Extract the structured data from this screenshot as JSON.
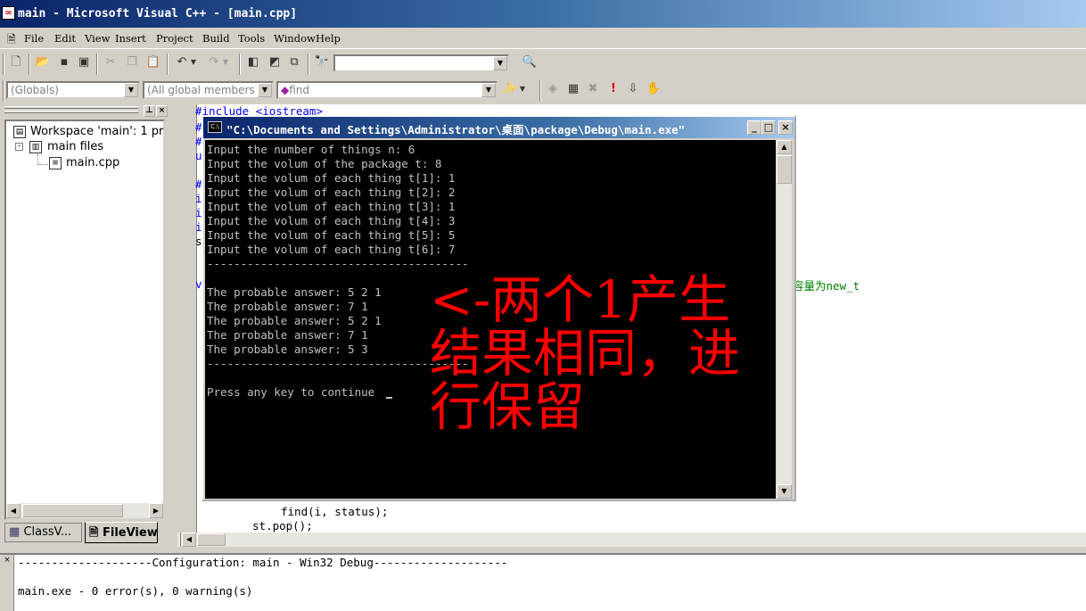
{
  "title": "main - Microsoft Visual C++ - [main.cpp]",
  "menu": [
    "File",
    "Edit",
    "View",
    "Insert",
    "Project",
    "Build",
    "Tools",
    "Window",
    "Help"
  ],
  "toolbar2": {
    "scope": "(Globals)",
    "members": "(All global members",
    "function": "find"
  },
  "workspace": {
    "root": "Workspace 'main': 1 pr",
    "folder": "main files",
    "file": "main.cpp",
    "tab1": "ClassV...",
    "tab2": "FileView"
  },
  "editor": {
    "line1": "#include <iostream>",
    "frag_right": "容量为new_t",
    "line_find": "find(i, status);",
    "line_pop": "st.pop();"
  },
  "console": {
    "title": "\"C:\\Documents and Settings\\Administrator\\桌面\\package\\Debug\\main.exe\"",
    "lines": [
      "Input the number of things n: 6",
      "Input the volum of the package t: 8",
      "Input the volum of each thing t[1]: 1",
      "Input the volum of each thing t[2]: 2",
      "Input the volum of each thing t[3]: 1",
      "Input the volum of each thing t[4]: 3",
      "Input the volum of each thing t[5]: 5",
      "Input the volum of each thing t[6]: 7",
      "---------------------------------------",
      "",
      "The probable answer: 5 2 1",
      "The probable answer: 7 1",
      "The probable answer: 5 2 1",
      "The probable answer: 7 1",
      "The probable answer: 5 3",
      "---------------------------------------",
      "",
      "Press any key to continue"
    ]
  },
  "annotation": {
    "line1": "<-两个1产生",
    "line2": "结果相同，进",
    "line3": "行保留"
  },
  "output": {
    "line1": "--------------------Configuration: main - Win32 Debug--------------------",
    "line2": "main.exe - 0 error(s), 0 warning(s)"
  }
}
